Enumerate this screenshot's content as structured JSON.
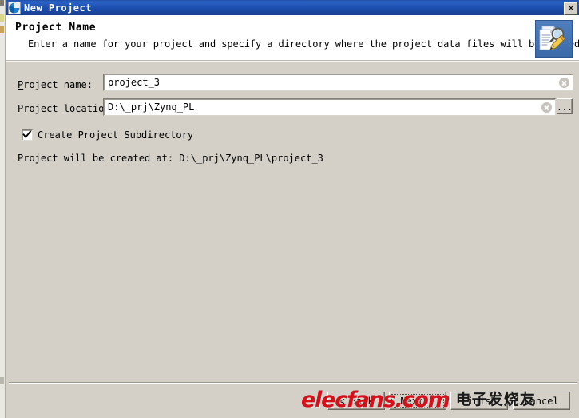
{
  "window": {
    "title": "New Project",
    "title_icon": "vivado-app-icon",
    "close_label": "✕"
  },
  "header": {
    "title": "Project Name",
    "description": "Enter a name for your project and specify a directory where the project data files will be stored",
    "icon": "new-project-wizard-icon"
  },
  "form": {
    "project_name": {
      "label_pre": "P",
      "label_post": "roject name:",
      "value": "project_3",
      "clear_icon": "clear-circle-icon"
    },
    "project_location": {
      "label_pre": "Project ",
      "label_mid": "l",
      "label_post": "ocation:",
      "value": "D:\\_prj\\Zynq_PL",
      "clear_icon": "clear-circle-icon",
      "browse_label": "..."
    },
    "create_subdirectory": {
      "label": "Create Project Subdirectory",
      "checked": true
    },
    "created_at": "Project will be created at: D:\\_prj\\Zynq_PL\\project_3"
  },
  "footer": {
    "back": "< Back",
    "next": "Next >",
    "finish": "Finish",
    "cancel": "Cancel"
  },
  "watermark": {
    "site": "elecfans.com",
    "cn": "电子发烧友"
  },
  "colors": {
    "titlebar": "#1f4fa8",
    "dialog_bg": "#d4d0c8",
    "header_bg": "#ffffff",
    "watermark_red": "#d4111b"
  }
}
